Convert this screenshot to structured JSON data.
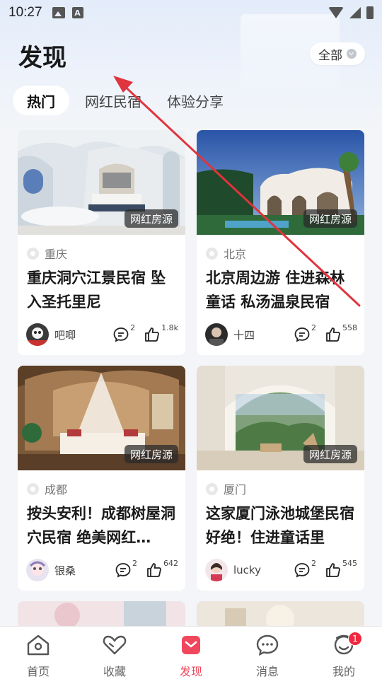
{
  "status_bar": {
    "time": "10:27",
    "a_icon_letter": "A"
  },
  "header": {
    "title": "发现",
    "filter_label": "全部"
  },
  "tabs": [
    {
      "label": "热门",
      "active": true
    },
    {
      "label": "网红民宿",
      "active": false
    },
    {
      "label": "体验分享",
      "active": false
    }
  ],
  "cards": [
    {
      "badge": "网红房源",
      "location": "重庆",
      "title": "重庆洞穴江景民宿 坠入圣托里尼",
      "author": "吧唧",
      "comments": "2",
      "likes": "1.8k"
    },
    {
      "badge": "网红房源",
      "location": "北京",
      "title": "北京周边游 住进森林童话 私汤温泉民宿",
      "author": "十四",
      "comments": "2",
      "likes": "558"
    },
    {
      "badge": "网红房源",
      "location": "成都",
      "title": "按头安利！成都树屋洞穴民宿 绝美网红…",
      "author": "银桑",
      "comments": "2",
      "likes": "642"
    },
    {
      "badge": "网红房源",
      "location": "厦门",
      "title": "这家厦门泳池城堡民宿好绝！住进童话里",
      "author": "lucky",
      "comments": "2",
      "likes": "545"
    }
  ],
  "tabbar": {
    "items": [
      {
        "label": "首页",
        "icon": "home-icon",
        "active": false
      },
      {
        "label": "收藏",
        "icon": "heart-icon",
        "active": false
      },
      {
        "label": "发现",
        "icon": "discover-icon",
        "active": true
      },
      {
        "label": "消息",
        "icon": "message-icon",
        "active": false
      },
      {
        "label": "我的",
        "icon": "profile-icon",
        "active": false,
        "badge": "1"
      }
    ]
  },
  "colors": {
    "accent": "#f0475d",
    "badge_red": "#f0283f",
    "arrow": "#e0343e"
  }
}
